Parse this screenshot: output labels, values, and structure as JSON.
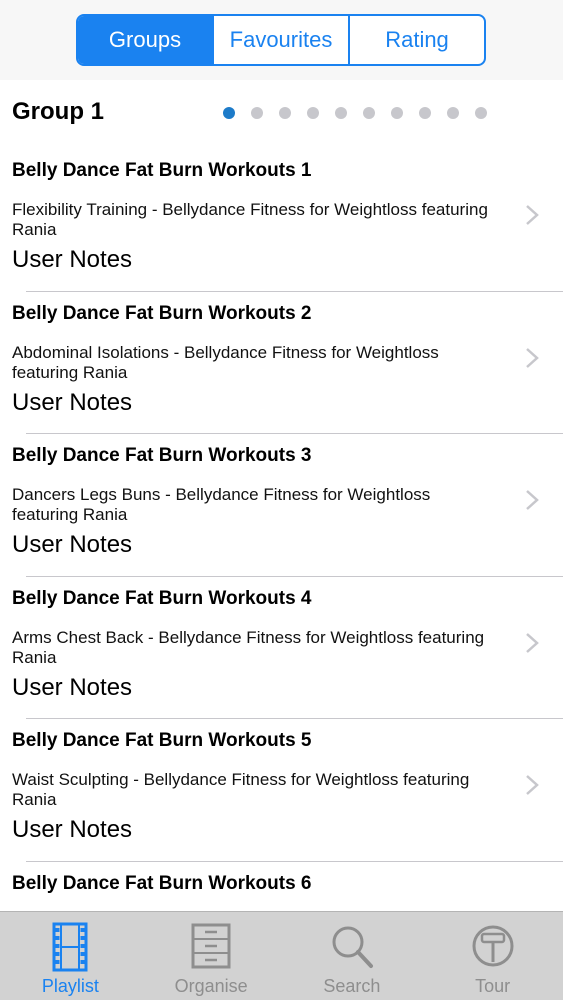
{
  "segments": [
    {
      "label": "Groups",
      "active": true
    },
    {
      "label": "Favourites",
      "active": false
    },
    {
      "label": "Rating",
      "active": false
    }
  ],
  "group": {
    "title": "Group 1",
    "page_count": 10,
    "current_page": 1
  },
  "rows": [
    {
      "title": "Belly Dance Fat Burn Workouts 1",
      "subtitle": "Flexibility Training - Bellydance Fitness for Weightloss featuring Rania",
      "notes": "User Notes"
    },
    {
      "title": "Belly Dance Fat Burn Workouts 2",
      "subtitle": "Abdominal Isolations - Bellydance Fitness for Weightloss featuring Rania",
      "notes": "User Notes"
    },
    {
      "title": "Belly Dance Fat Burn Workouts 3",
      "subtitle": "Dancers Legs  Buns - Bellydance Fitness for Weightloss featuring Rania",
      "notes": "User Notes"
    },
    {
      "title": "Belly Dance Fat Burn Workouts 4",
      "subtitle": "Arms Chest  Back - Bellydance Fitness for Weightloss featuring Rania",
      "notes": "User Notes"
    },
    {
      "title": "Belly Dance Fat Burn Workouts 5",
      "subtitle": "Waist Sculpting - Bellydance Fitness for Weightloss featuring Rania",
      "notes": "User Notes"
    },
    {
      "title": "Belly Dance Fat Burn Workouts 6",
      "subtitle": "",
      "notes": ""
    }
  ],
  "tabs": [
    {
      "label": "Playlist",
      "icon": "film-strip-icon",
      "active": true
    },
    {
      "label": "Organise",
      "icon": "filing-cabinet-icon",
      "active": false
    },
    {
      "label": "Search",
      "icon": "magnifier-icon",
      "active": false
    },
    {
      "label": "Tour",
      "icon": "signpost-icon",
      "active": false
    }
  ],
  "colors": {
    "accent": "#1a82f0",
    "page_dot_active": "#1d7bc9",
    "page_dot_inactive": "#c7c7cc",
    "tab_bar": "#d2d2d2",
    "tab_inactive": "#8e8e8e"
  }
}
